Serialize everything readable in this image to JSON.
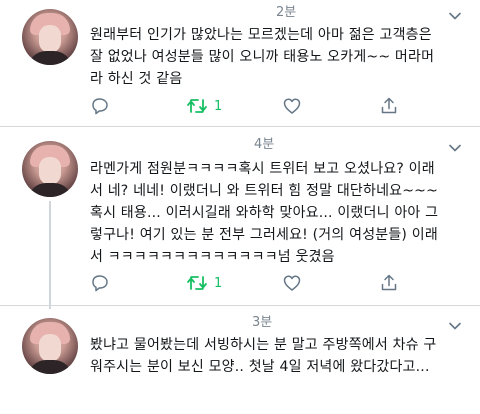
{
  "tweets": [
    {
      "time": "2분",
      "text": "원래부터 인기가 많았나는 모르겠는데 아마 젊은 고객층은\n잘 없었나 여성분들 많이 오니까 태용노 오카게~~ 머라머\n라 하신 것 같음",
      "retweet_count": "1"
    },
    {
      "time": "4분",
      "text": "라멘가게 점원분ㅋㅋㅋㅋ혹시 트위터 보고 오셨나요? 이래\n서 네? 네네! 이랬더니 와 트위터 힘 정말 대단하네요~~~\n혹시 태용... 이러시길래 와하학 맞아요... 이랬더니 아아 그\n렇구나! 여기 있는 분 전부 그러세요! (거의 여성분들) 이래\n서 ㅋㅋㅋㅋㅋㅋㅋㅋㅋㅋㅋㅋㅋ넘 웃겼음",
      "retweet_count": "1"
    },
    {
      "time": "3분",
      "text": "봤냐고 물어봤는데 서빙하시는 분 말고 주방쪽에서 차슈 구\n워주시는 분이 보신 모양.. 첫날 4일 저녁에 왔다갔다고..."
    }
  ],
  "icons": {
    "reply": "reply-icon",
    "retweet": "retweet-icon",
    "like": "heart-icon",
    "share": "share-icon",
    "more": "chevron-down-icon"
  },
  "colors": {
    "retweet_active": "#17bf63",
    "icon_gray": "#657786",
    "divider": "#d6d9dc"
  }
}
